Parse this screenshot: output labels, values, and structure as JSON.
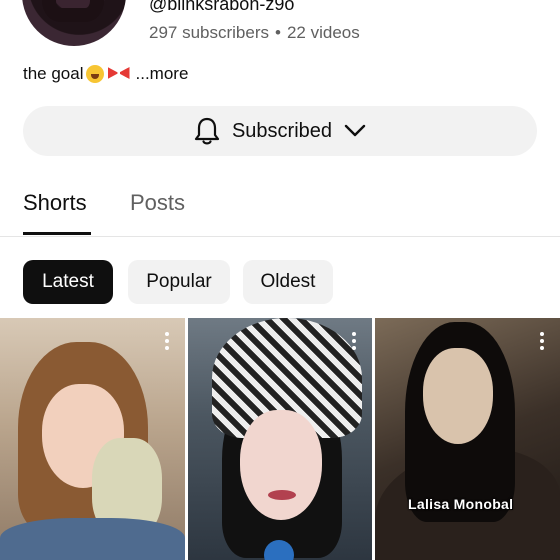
{
  "channel": {
    "handle": "@blinksrabon-z9o",
    "subscribers": "297 subscribers",
    "separator": "•",
    "videos": "22 videos",
    "description": "the goal",
    "more_label": "...more",
    "description_emojis": [
      "weary-face-icon",
      "ribbon-icon"
    ]
  },
  "subscribe_button": {
    "label": "Subscribed",
    "icon": "bell-icon",
    "dropdown_icon": "chevron-down-icon"
  },
  "tabs": [
    {
      "label": "Shorts",
      "active": true
    },
    {
      "label": "Posts",
      "active": false
    }
  ],
  "filters": [
    {
      "label": "Latest",
      "selected": true
    },
    {
      "label": "Popular",
      "selected": false
    },
    {
      "label": "Oldest",
      "selected": false
    }
  ],
  "shorts": [
    {
      "caption": ""
    },
    {
      "caption": ""
    },
    {
      "caption": "Lalisa Monobal"
    }
  ],
  "colors": {
    "text_primary": "#0f0f0f",
    "text_secondary": "#606060",
    "chip_selected_bg": "#0f0f0f",
    "chip_bg": "#f2f2f2"
  }
}
